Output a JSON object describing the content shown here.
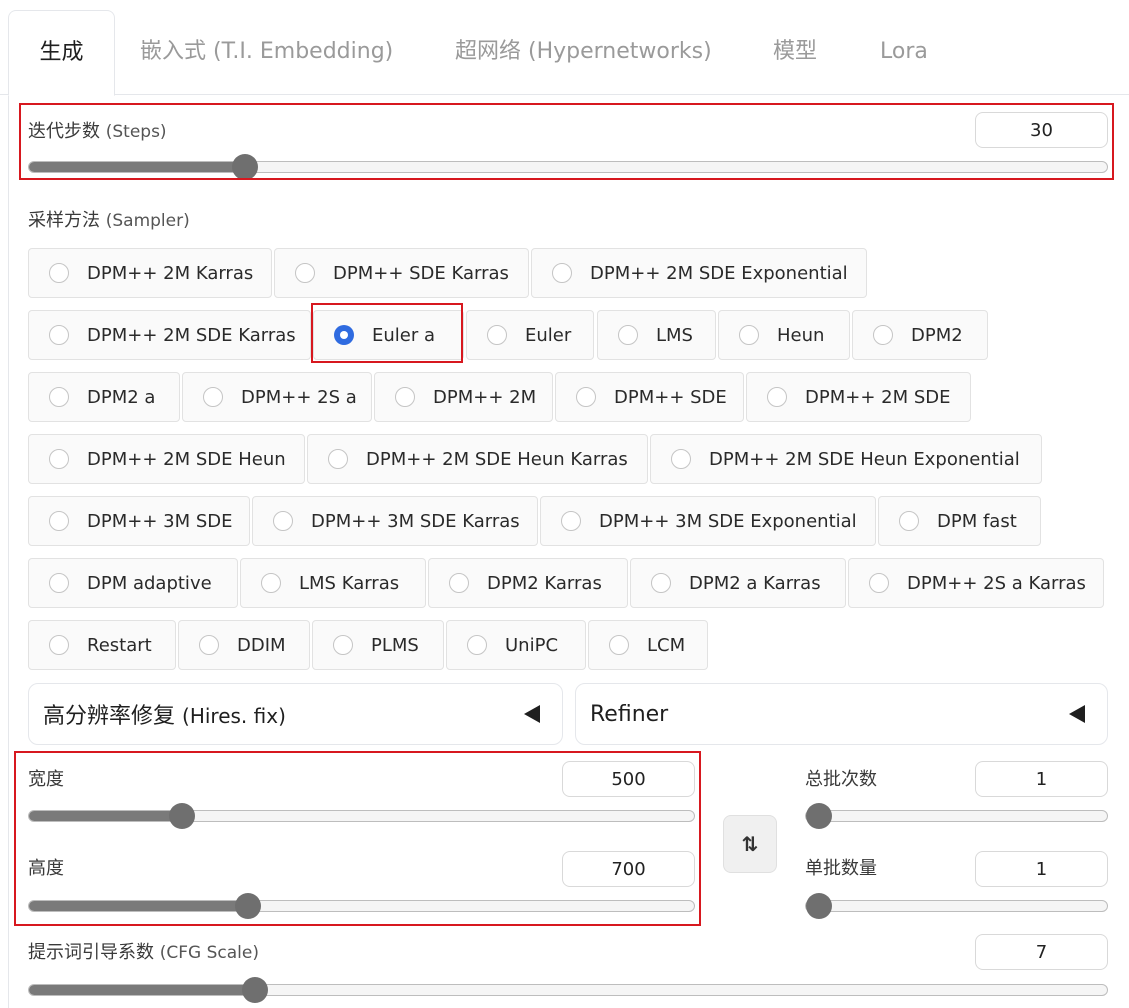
{
  "tabs": [
    {
      "label": "生成",
      "active": true
    },
    {
      "label": "嵌入式 (T.I. Embedding)",
      "active": false
    },
    {
      "label": "超网络 (Hypernetworks)",
      "active": false
    },
    {
      "label": "模型",
      "active": false
    },
    {
      "label": "Lora",
      "active": false
    }
  ],
  "steps": {
    "label": "迭代步数",
    "label_en": "(Steps)",
    "value": "30",
    "fraction": 0.2
  },
  "sampler": {
    "label": "采样方法",
    "label_en": "(Sampler)",
    "selected": "Euler a",
    "options": [
      "DPM++ 2M Karras",
      "DPM++ SDE Karras",
      "DPM++ 2M SDE Exponential",
      "DPM++ 2M SDE Karras",
      "Euler a",
      "Euler",
      "LMS",
      "Heun",
      "DPM2",
      "DPM2 a",
      "DPM++ 2S a",
      "DPM++ 2M",
      "DPM++ SDE",
      "DPM++ 2M SDE",
      "DPM++ 2M SDE Heun",
      "DPM++ 2M SDE Heun Karras",
      "DPM++ 2M SDE Heun Exponential",
      "DPM++ 3M SDE",
      "DPM++ 3M SDE Karras",
      "DPM++ 3M SDE Exponential",
      "DPM fast",
      "DPM adaptive",
      "LMS Karras",
      "DPM2 Karras",
      "DPM2 a Karras",
      "DPM++ 2S a Karras",
      "Restart",
      "DDIM",
      "PLMS",
      "UniPC",
      "LCM"
    ]
  },
  "hires": {
    "label": "高分辨率修复",
    "label_en": "(Hires. fix)"
  },
  "refiner": {
    "label": "Refiner"
  },
  "width": {
    "label": "宽度",
    "value": "500",
    "fraction": 0.23
  },
  "height": {
    "label": "高度",
    "value": "700",
    "fraction": 0.33
  },
  "swap_icon": {
    "glyph": "⇅",
    "icon": "swap-arrows-icon"
  },
  "batch_count": {
    "label": "总批次数",
    "value": "1",
    "fraction": 0.0
  },
  "batch_size": {
    "label": "单批数量",
    "value": "1",
    "fraction": 0.0
  },
  "cfg": {
    "label": "提示词引导系数",
    "label_en": "(CFG Scale)",
    "value": "7",
    "fraction": 0.21
  },
  "colors": {
    "accent": "#2f6be0",
    "highlight": "#d7181f"
  }
}
